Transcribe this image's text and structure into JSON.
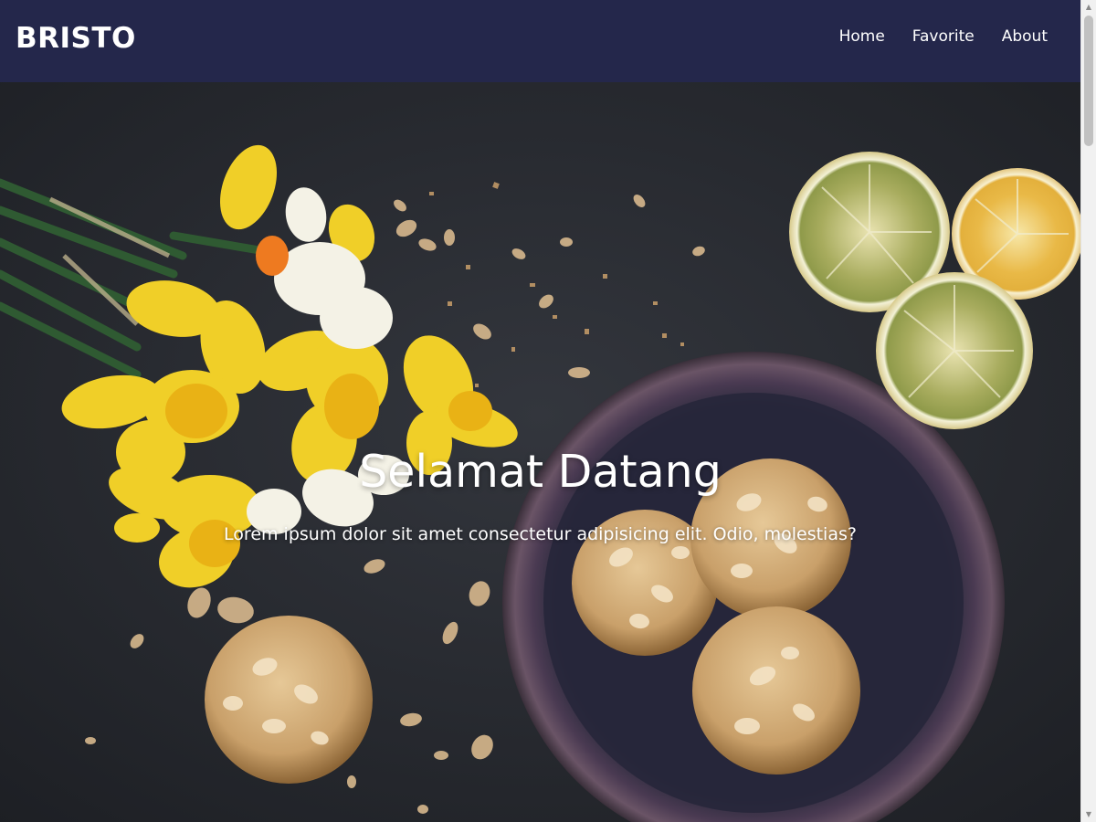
{
  "navbar": {
    "brand": "BRISTO",
    "links": [
      {
        "label": "Home"
      },
      {
        "label": "Favorite"
      },
      {
        "label": "About"
      }
    ]
  },
  "hero": {
    "title": "Selamat Datang",
    "subtitle": "Lorem ipsum dolor sit amet consectetur adipisicing elit. Odio, molestias?"
  },
  "colors": {
    "navbar_bg": "#24274b",
    "hero_bg": "#2a2c33",
    "text": "#ffffff"
  },
  "icons": {
    "scroll_up": "triangle-up-icon",
    "scroll_down": "triangle-down-icon"
  }
}
